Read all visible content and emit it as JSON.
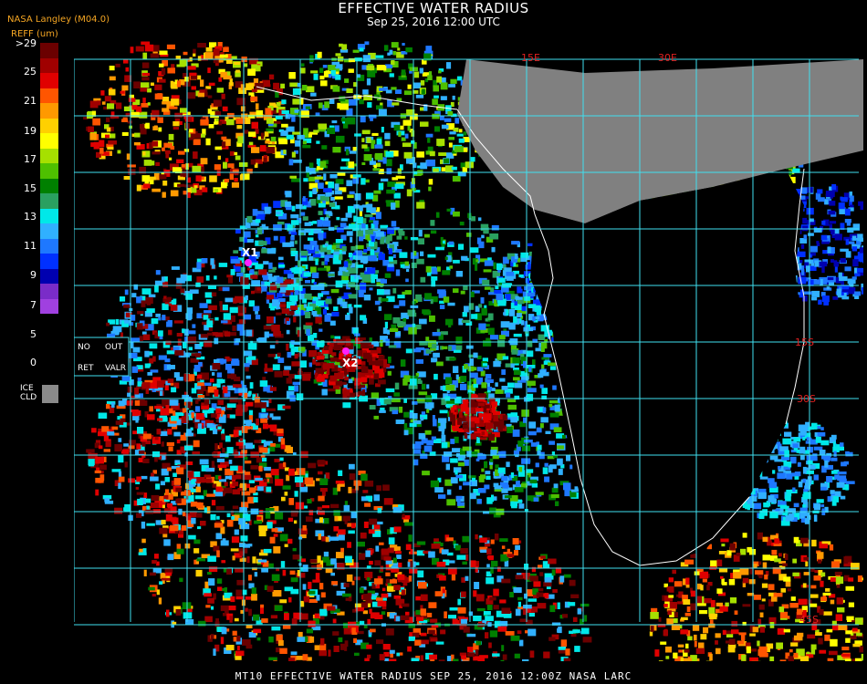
{
  "header": {
    "title": "EFFECTIVE WATER RADIUS",
    "subtitle": "Sep 25, 2016 12:00 UTC",
    "source": "NASA Langley (M04.0)",
    "units": "REFF (um)"
  },
  "colorbar": {
    "top_label": ">29",
    "ticks": [
      "25",
      "21",
      "19",
      "17",
      "15",
      "13",
      "11",
      "9",
      "7",
      "5",
      "0"
    ],
    "colors": [
      "#6b0000",
      "#a00000",
      "#e00000",
      "#ff5500",
      "#ff9900",
      "#ffd000",
      "#ffff00",
      "#a6e000",
      "#4ec000",
      "#008000",
      "#2aa060",
      "#00e8e8",
      "#30b0ff",
      "#1e78ff",
      "#0030ff",
      "#0000b0",
      "#7a2cc8",
      "#a040e0"
    ],
    "ice_label_1": "ICE",
    "ice_label_2": "CLD",
    "ice_color": "#8a8a8a"
  },
  "map": {
    "legend_box": {
      "no": "NO",
      "out": "OUT",
      "ret": "RET",
      "valr": "VALR"
    },
    "markers": [
      {
        "label": "X1"
      },
      {
        "label": "X2"
      }
    ],
    "lat_labels": [
      "15S",
      "30S",
      "45S"
    ],
    "top_labels": [
      "15E",
      "30E"
    ],
    "grid_color": "#40e0f0",
    "coast_color": "#ffffff",
    "land_color": "#808080",
    "ocean_color": "#000000"
  },
  "footer": {
    "text": "MT10  EFFECTIVE WATER RADIUS  SEP 25, 2016 12:00Z  NASA LARC"
  }
}
